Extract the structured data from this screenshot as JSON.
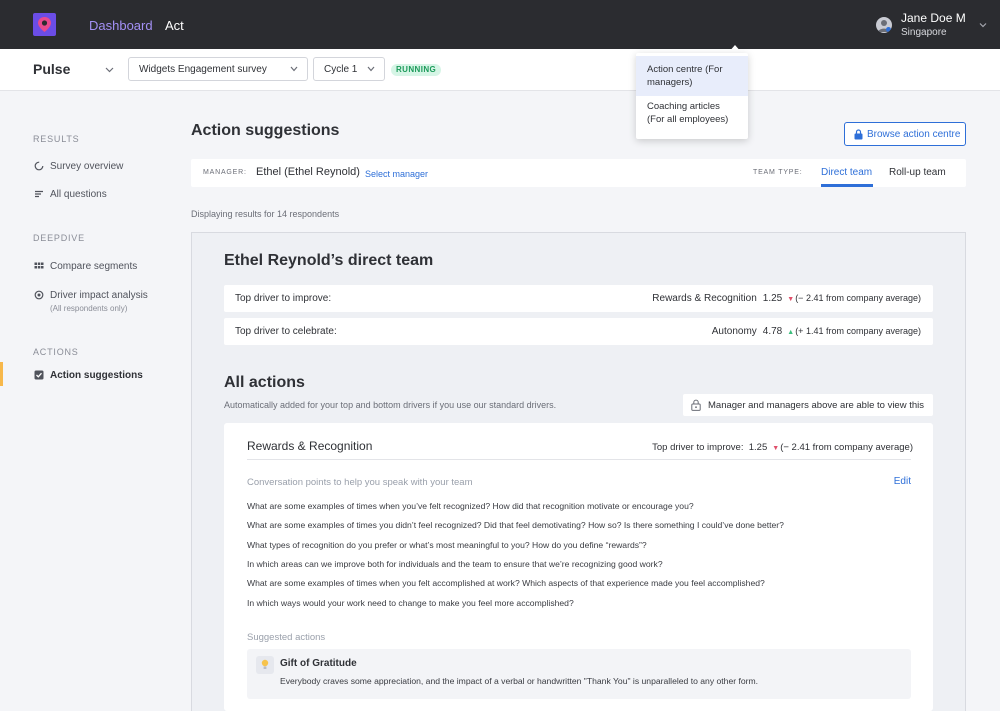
{
  "topnav": {
    "tabs": [
      {
        "label": "Dashboard"
      },
      {
        "label": "Act"
      }
    ],
    "user": {
      "name": "Jane Doe M",
      "location": "Singapore"
    },
    "dropdown": [
      {
        "line1": "Action centre (For",
        "line2": "managers)"
      },
      {
        "line1": "Coaching articles",
        "line2": "(For all employees)"
      }
    ]
  },
  "subbar": {
    "app": "Pulse",
    "survey": "Widgets Engagement survey",
    "cycle": "Cycle 1",
    "status": "RUNNING"
  },
  "sidebar": {
    "sections": [
      {
        "heading": "RESULTS",
        "items": [
          {
            "label": "Survey overview",
            "icon": "circle-icon"
          },
          {
            "label": "All questions",
            "icon": "list-icon"
          }
        ]
      },
      {
        "heading": "DEEPDIVE",
        "items": [
          {
            "label": "Compare segments",
            "icon": "grid-icon"
          },
          {
            "label": "Driver impact analysis",
            "sub": "(All respondents only)",
            "icon": "target-icon"
          }
        ]
      },
      {
        "heading": "ACTIONS",
        "items": [
          {
            "label": "Action suggestions",
            "icon": "checkbox-icon"
          }
        ]
      }
    ]
  },
  "main": {
    "title": "Action suggestions",
    "browse_label": "Browse action centre",
    "manager_label": "MANAGER:",
    "manager_name": "Ethel (Ethel Reynold)",
    "select_manager": "Select manager",
    "team_type_label": "TEAM TYPE:",
    "team_tabs": [
      {
        "label": "Direct team"
      },
      {
        "label": "Roll-up team"
      }
    ],
    "results_text": "Displaying results for 14 respondents",
    "team_title": "Ethel Reynold’s direct team",
    "drivers": [
      {
        "label": "Top driver to improve:",
        "name": "Rewards & Recognition",
        "score": "1.25",
        "diff": "(− 2.41 from company average)",
        "trend": "down"
      },
      {
        "label": "Top driver to celebrate:",
        "name": "Autonomy",
        "score": "4.78",
        "diff": "(+ 1.41 from company average)",
        "trend": "up"
      }
    ],
    "all_actions_title": "All actions",
    "auto_text": "Automatically added for your top and bottom drivers if you use our standard drivers.",
    "privacy_text": "Manager and managers above are able to view this",
    "card": {
      "title": "Rewards & Recognition",
      "driver_label": "Top driver to improve:",
      "score": "1.25",
      "diff": "(− 2.41 from company average)",
      "conv_heading": "Conversation points to help you speak with your team",
      "edit_label": "Edit",
      "questions": [
        "What are some examples of times when you’ve felt recognized? How did that recognition motivate or encourage you?",
        "What are some examples of times you didn’t feel recognized? Did that feel demotivating? How so? Is there something I could’ve done better?",
        "What types of recognition do you prefer or what’s most meaningful to you? How do you define “rewards”?",
        "In which areas can we improve both for individuals and the team to ensure that we’re recognizing good work?",
        "What are some examples of times when you felt accomplished at work? Which aspects of that experience made you feel accomplished?",
        "In which ways would your work need to change to make you feel more accomplished?"
      ],
      "suggested_heading": "Suggested actions",
      "suggestion": {
        "title": "Gift of Gratitude",
        "desc": "Everybody craves some appreciation, and the impact of a verbal or handwritten \"Thank You\" is unparalleled to any other form.",
        "icon": "lightbulb-icon"
      }
    }
  },
  "colors": {
    "accent": "#2e6fd8",
    "nav_bg": "#2b2c30",
    "nav_active": "#a390f5",
    "running": "#1c9a5a",
    "down": "#e0506b",
    "up": "#3cbf7d"
  }
}
